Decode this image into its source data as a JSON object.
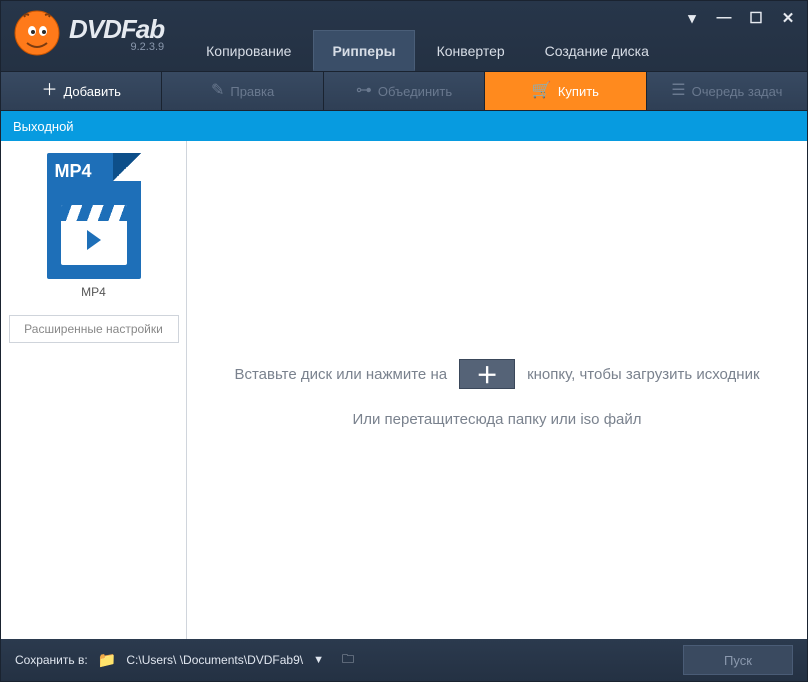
{
  "app": {
    "name": "DVDFab",
    "version": "9.2.3.9"
  },
  "window_controls": {
    "dropdown": "▾",
    "minimize": "—",
    "maximize": "☐",
    "close": "✕"
  },
  "tabs": [
    {
      "label": "Копирование",
      "active": false
    },
    {
      "label": "Рипперы",
      "active": true
    },
    {
      "label": "Конвертер",
      "active": false
    },
    {
      "label": "Создание диска",
      "active": false
    }
  ],
  "toolbar": {
    "add": {
      "label": "Добавить",
      "icon": "＋"
    },
    "edit": {
      "label": "Правка",
      "icon": "✎"
    },
    "merge": {
      "label": "Объединить",
      "icon": "⊶"
    },
    "buy": {
      "label": "Купить",
      "icon": "🛒"
    },
    "queue": {
      "label": "Очередь задач",
      "icon": "☰"
    }
  },
  "subheader": {
    "label": "Выходной"
  },
  "sidebar": {
    "format_badge": "MP4",
    "format_name": "MP4",
    "advanced_label": "Расширенные настройки"
  },
  "canvas": {
    "line1_before": "Вставьте диск или нажмите на",
    "line1_after": "кнопку, чтобы загрузить исходник",
    "plus": "＋",
    "line2": "Или перетащитесюда папку или iso файл"
  },
  "footer": {
    "save_to_label": "Сохранить в:",
    "path": "C:\\Users\\      \\Documents\\DVDFab9\\",
    "start_label": "Пуск"
  }
}
